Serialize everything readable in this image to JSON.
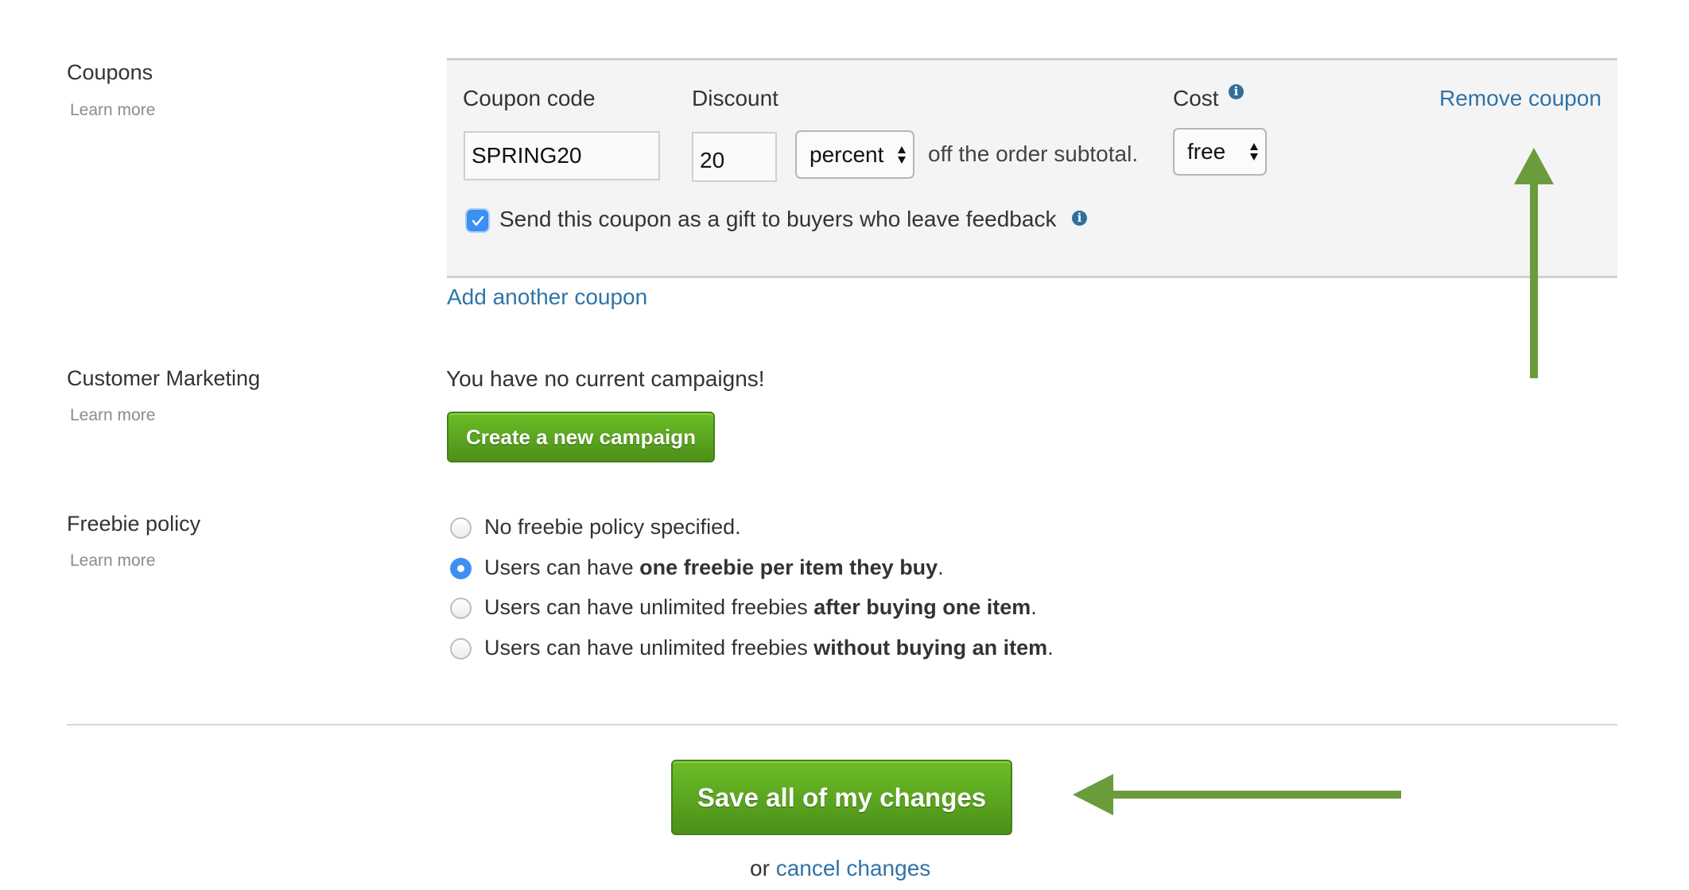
{
  "coupons": {
    "label": "Coupons",
    "learn_more": "Learn more",
    "panel": {
      "coupon_code_label": "Coupon code",
      "coupon_code_value": "SPRING20",
      "discount_label": "Discount",
      "discount_value": "20",
      "discount_type_selected": "percent",
      "discount_suffix": "off the order subtotal.",
      "cost_label": "Cost",
      "cost_selected": "free",
      "remove_link": "Remove coupon",
      "gift_checkbox_checked": true,
      "gift_checkbox_label": "Send this coupon as a gift to buyers who leave feedback"
    },
    "add_another": "Add another coupon"
  },
  "customer_marketing": {
    "label": "Customer Marketing",
    "learn_more": "Learn more",
    "status_text": "You have no current campaigns!",
    "create_button": "Create a new campaign"
  },
  "freebie_policy": {
    "label": "Freebie policy",
    "learn_more": "Learn more",
    "selected_index": 1,
    "options": [
      {
        "prefix": "No freebie policy specified.",
        "bold": "",
        "suffix": ""
      },
      {
        "prefix": "Users can have ",
        "bold": "one freebie per item they buy",
        "suffix": "."
      },
      {
        "prefix": "Users can have unlimited freebies ",
        "bold": "after buying one item",
        "suffix": "."
      },
      {
        "prefix": "Users can have unlimited freebies ",
        "bold": "without buying an item",
        "suffix": "."
      }
    ]
  },
  "footer": {
    "save_button": "Save all of my changes",
    "or_text": "or",
    "cancel_link": "cancel changes"
  },
  "annotations": {
    "arrow_color": "#6a9c3c"
  },
  "colors": {
    "link": "#2f74a8",
    "button_green": "#5aa61f",
    "checkbox_blue": "#3d8ff2"
  }
}
